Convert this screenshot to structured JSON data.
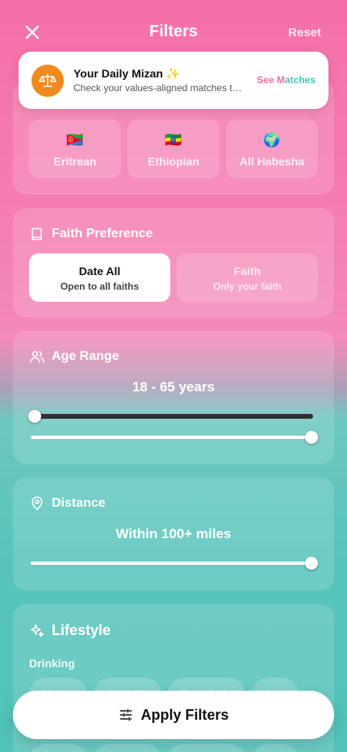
{
  "header": {
    "title": "Filters",
    "reset_label": "Reset"
  },
  "banner": {
    "title": "Your Daily Mizan ✨",
    "subtitle": "Check your values-aligned matches today",
    "link_label": "See Matches"
  },
  "nationality": {
    "options": [
      {
        "flag": "🇪🇷",
        "label": "Eritrean"
      },
      {
        "flag": "🇪🇹",
        "label": "Ethiopian"
      },
      {
        "flag": "🌍",
        "label": "All Habesha"
      }
    ]
  },
  "faith": {
    "title": "Faith Preference",
    "options": [
      {
        "title": "Date All",
        "subtitle": "Open to all faiths",
        "selected": true
      },
      {
        "title": "Faith",
        "subtitle": "Only your faith",
        "selected": false
      }
    ]
  },
  "age": {
    "title": "Age Range",
    "value_text": "18 - 65 years",
    "min": 18,
    "max": 65
  },
  "distance": {
    "title": "Distance",
    "value_text": "Within 100+ miles",
    "value": 100
  },
  "lifestyle": {
    "title": "Lifestyle",
    "drinking_label": "Drinking",
    "chips": [
      "Never",
      "Socially",
      "Regularly",
      "Any"
    ]
  },
  "apply_label": "Apply Filters",
  "colors": {
    "pink": "#f56fa8",
    "teal": "#52c2b8",
    "accent_orange": "#f08a1e"
  }
}
